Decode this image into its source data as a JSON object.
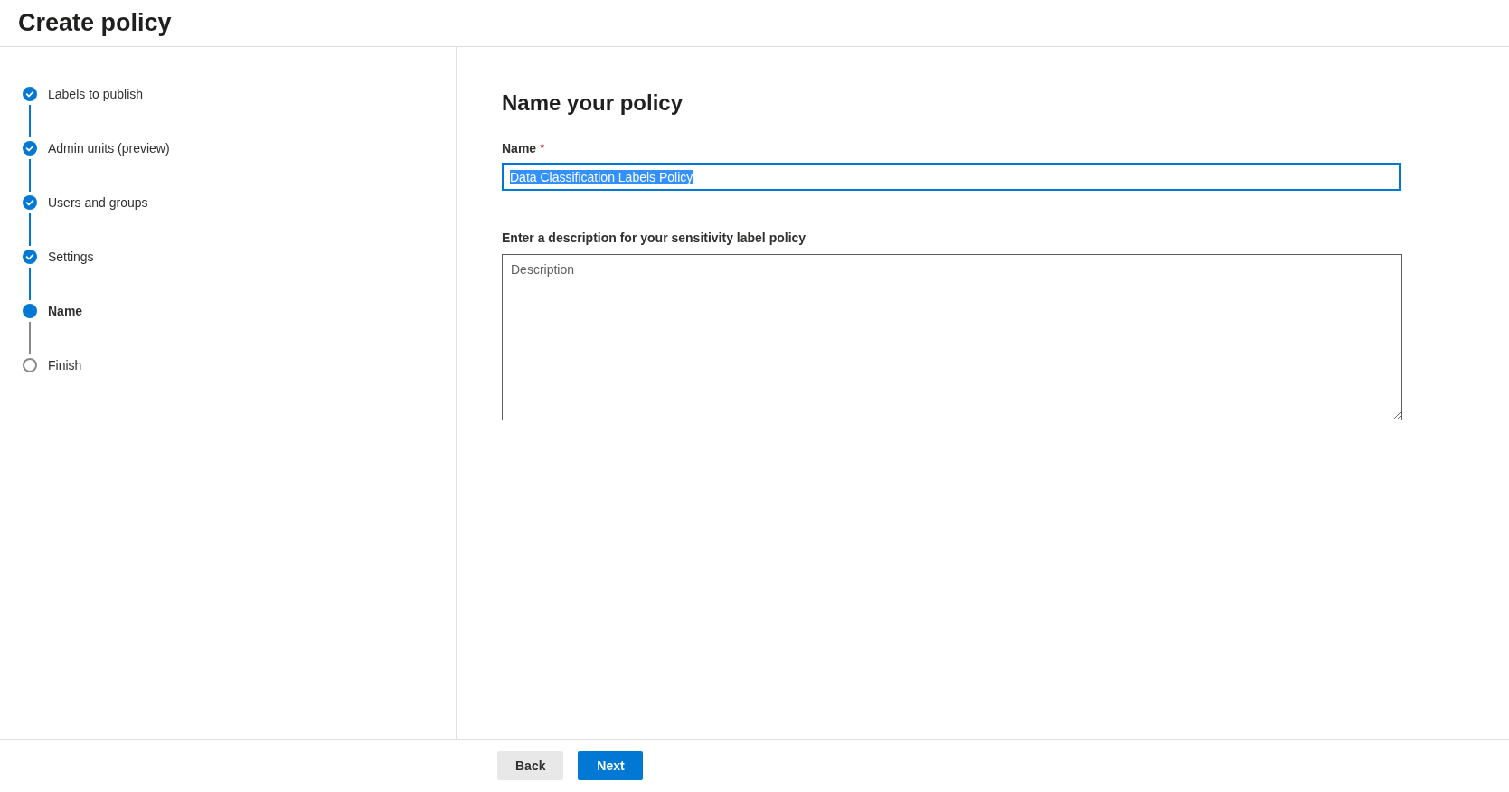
{
  "header": {
    "title": "Create policy"
  },
  "steps": [
    {
      "label": "Labels to publish",
      "completed": true,
      "selected": false
    },
    {
      "label": "Admin units (preview)",
      "completed": true,
      "selected": false
    },
    {
      "label": "Users and groups",
      "completed": true,
      "selected": false
    },
    {
      "label": "Settings",
      "completed": true,
      "selected": false
    },
    {
      "label": "Name",
      "completed": false,
      "selected": true
    },
    {
      "label": "Finish",
      "completed": false,
      "selected": false
    }
  ],
  "form": {
    "heading": "Name your policy",
    "name_label": "Name",
    "required_mark": "*",
    "name_field": {
      "value": "Data Classification Labels Policy",
      "text_selected": true,
      "focused": true
    },
    "description_label": "Enter a description for your sensitivity label policy",
    "description_field": {
      "placeholder": "Description"
    }
  },
  "buttons": [
    {
      "label": "Back",
      "kind": "secondary"
    },
    {
      "label": "Next",
      "kind": "primary"
    }
  ]
}
